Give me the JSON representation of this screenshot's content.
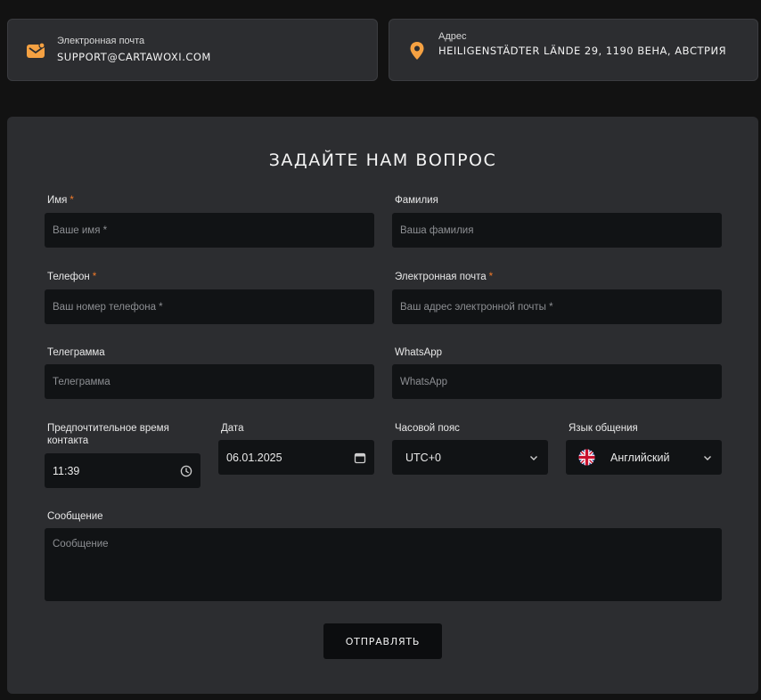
{
  "contacts": {
    "email": {
      "label": "Электронная почта",
      "value": "SUPPORT@CARTAWOXI.COM"
    },
    "address": {
      "label": "Адрес",
      "value": "HEILIGENSTÄDTER LÄNDE 29, 1190 ВЕНА, АВСТРИЯ"
    }
  },
  "form": {
    "title": "ЗАДАЙТЕ НАМ ВОПРОС",
    "first_name": {
      "label": "Имя",
      "required": "*",
      "placeholder": "Ваше имя *"
    },
    "last_name": {
      "label": "Фамилия",
      "placeholder": "Ваша фамилия"
    },
    "phone": {
      "label": "Телефон",
      "required": "*",
      "placeholder": "Ваш номер телефона *"
    },
    "email": {
      "label": "Электронная почта",
      "required": "*",
      "placeholder": "Ваш адрес электронной почты *"
    },
    "telegram": {
      "label": "Телеграмма",
      "placeholder": "Телеграмма"
    },
    "whatsapp": {
      "label": "WhatsApp",
      "placeholder": "WhatsApp"
    },
    "contact_time": {
      "label": "Предпочтительное время контакта",
      "value": "11:39"
    },
    "date": {
      "label": "Дата",
      "value": "06.01.2025"
    },
    "timezone": {
      "label": "Часовой пояс",
      "value": "UTC+0"
    },
    "language": {
      "label": "Язык общения",
      "value": "Английский"
    },
    "message": {
      "label": "Сообщение",
      "placeholder": "Сообщение"
    },
    "submit_label": "ОТПРАВЛЯТЬ"
  },
  "colors": {
    "accent": "#f5a142",
    "required": "#f07a2a",
    "panel": "#2c2d30",
    "field": "#111315"
  }
}
